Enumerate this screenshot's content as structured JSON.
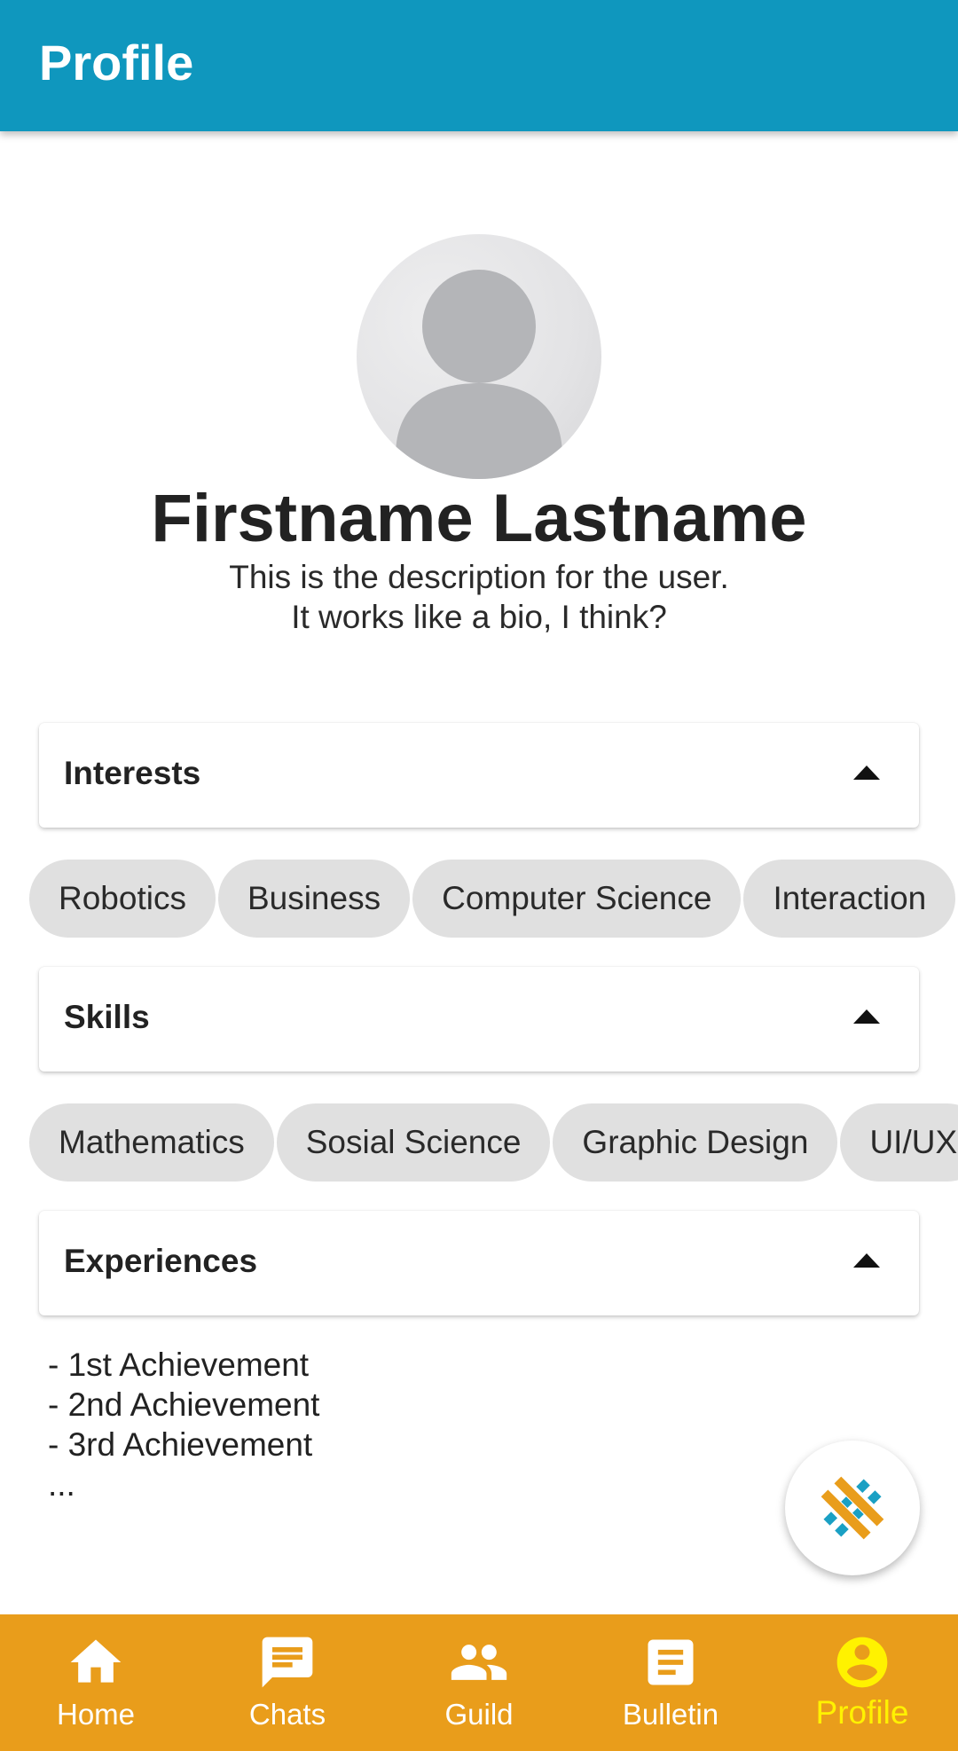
{
  "appbar": {
    "title": "Profile"
  },
  "profile": {
    "name": "Firstname Lastname",
    "bio_line1": "This is the description for the user.",
    "bio_line2": "It works like a bio, I think?"
  },
  "sections": {
    "interests": {
      "title": "Interests",
      "expanded": true,
      "chips": [
        "Robotics",
        "Business",
        "Computer Science",
        "Interaction"
      ]
    },
    "skills": {
      "title": "Skills",
      "expanded": true,
      "chips": [
        "Mathematics",
        "Sosial Science",
        "Graphic Design",
        "UI/UX"
      ]
    },
    "experiences": {
      "title": "Experiences",
      "expanded": true,
      "items": [
        "- 1st Achievement",
        "- 2nd Achievement",
        "- 3rd Achievement",
        "..."
      ]
    }
  },
  "fab": {
    "icon": "app-logo-icon"
  },
  "bottom_nav": {
    "items": [
      {
        "label": "Home",
        "icon": "home-icon"
      },
      {
        "label": "Chats",
        "icon": "chat-icon"
      },
      {
        "label": "Guild",
        "icon": "group-icon"
      },
      {
        "label": "Bulletin",
        "icon": "bulletin-icon"
      },
      {
        "label": "Profile",
        "icon": "account-circle-icon"
      }
    ],
    "active": "Profile"
  },
  "colors": {
    "appbar": "#0f97be",
    "bottom_nav": "#e99d1b",
    "active_nav": "#fff200",
    "chip": "#e0e0e0"
  }
}
